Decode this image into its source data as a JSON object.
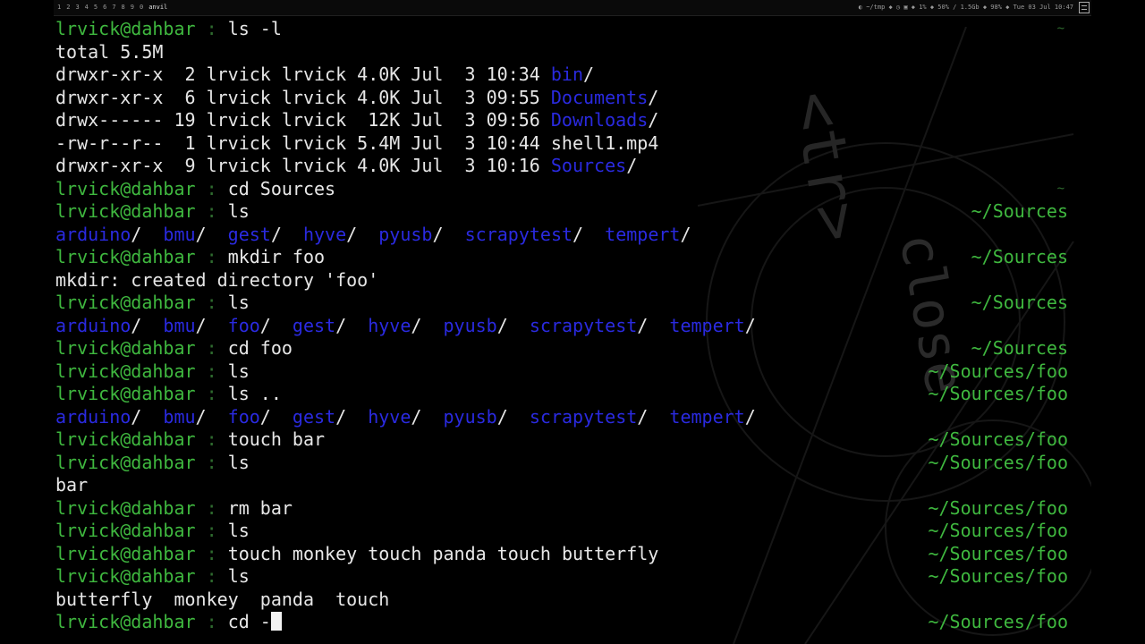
{
  "topbar": {
    "workspaces": [
      "1",
      "2",
      "3",
      "4",
      "5",
      "6",
      "7",
      "8",
      "9",
      "0",
      "anvil"
    ],
    "status": "◐ ~/tmp  ◆ ◷ ▣ ◆ 1% ◆ 50% / 1.5Gb ◆ 98% ◆ Tue 03 Jul 10:47"
  },
  "wallpaper_text": [
    "<tr>",
    "close"
  ],
  "prompt": {
    "user": "lrvick@dahbar",
    "sep": " :"
  },
  "lines": [
    {
      "type": "prompt",
      "cmd": "ls -l",
      "rp": "",
      "marker": "~"
    },
    {
      "type": "text",
      "text": "total 5.5M"
    },
    {
      "type": "lsl",
      "perms": "drwxr-xr-x  2 lrvick lrvick 4.0K Jul  3 10:34 ",
      "name": "bin",
      "dir": true
    },
    {
      "type": "lsl",
      "perms": "drwxr-xr-x  6 lrvick lrvick 4.0K Jul  3 09:55 ",
      "name": "Documents",
      "dir": true
    },
    {
      "type": "lsl",
      "perms": "drwx------ 19 lrvick lrvick  12K Jul  3 09:56 ",
      "name": "Downloads",
      "dir": true
    },
    {
      "type": "lsl",
      "perms": "-rw-r--r--  1 lrvick lrvick 5.4M Jul  3 10:44 ",
      "name": "shell1.mp4",
      "dir": false
    },
    {
      "type": "lsl",
      "perms": "drwxr-xr-x  9 lrvick lrvick 4.0K Jul  3 10:16 ",
      "name": "Sources",
      "dir": true
    },
    {
      "type": "prompt",
      "cmd": "cd Sources",
      "rp": "",
      "marker": "~"
    },
    {
      "type": "prompt",
      "cmd": "ls",
      "rp": "~/Sources"
    },
    {
      "type": "dirs",
      "items": [
        "arduino",
        "bmu",
        "gest",
        "hyve",
        "pyusb",
        "scrapytest",
        "tempert"
      ]
    },
    {
      "type": "prompt",
      "cmd": "mkdir foo",
      "rp": "~/Sources"
    },
    {
      "type": "text",
      "text": "mkdir: created directory 'foo'"
    },
    {
      "type": "prompt",
      "cmd": "ls",
      "rp": "~/Sources"
    },
    {
      "type": "dirs",
      "items": [
        "arduino",
        "bmu",
        "foo",
        "gest",
        "hyve",
        "pyusb",
        "scrapytest",
        "tempert"
      ]
    },
    {
      "type": "prompt",
      "cmd": "cd foo",
      "rp": "~/Sources"
    },
    {
      "type": "prompt",
      "cmd": "ls",
      "rp": "~/Sources/foo"
    },
    {
      "type": "prompt",
      "cmd": "ls ..",
      "rp": "~/Sources/foo"
    },
    {
      "type": "dirs",
      "items": [
        "arduino",
        "bmu",
        "foo",
        "gest",
        "hyve",
        "pyusb",
        "scrapytest",
        "tempert"
      ]
    },
    {
      "type": "prompt",
      "cmd": "touch bar",
      "rp": "~/Sources/foo"
    },
    {
      "type": "prompt",
      "cmd": "ls",
      "rp": "~/Sources/foo"
    },
    {
      "type": "text",
      "text": "bar"
    },
    {
      "type": "prompt",
      "cmd": "rm bar",
      "rp": "~/Sources/foo"
    },
    {
      "type": "prompt",
      "cmd": "ls",
      "rp": "~/Sources/foo"
    },
    {
      "type": "prompt",
      "cmd": "touch monkey touch panda touch butterfly",
      "rp": "~/Sources/foo"
    },
    {
      "type": "prompt",
      "cmd": "ls",
      "rp": "~/Sources/foo"
    },
    {
      "type": "text",
      "text": "butterfly  monkey  panda  touch"
    },
    {
      "type": "prompt",
      "cmd": "cd -",
      "rp": "~/Sources/foo",
      "cursor": true
    }
  ],
  "colors": {
    "prompt_user": "#3fb83f",
    "directory": "#2a2ae0",
    "text": "#e6e6e6",
    "background": "#000000"
  }
}
